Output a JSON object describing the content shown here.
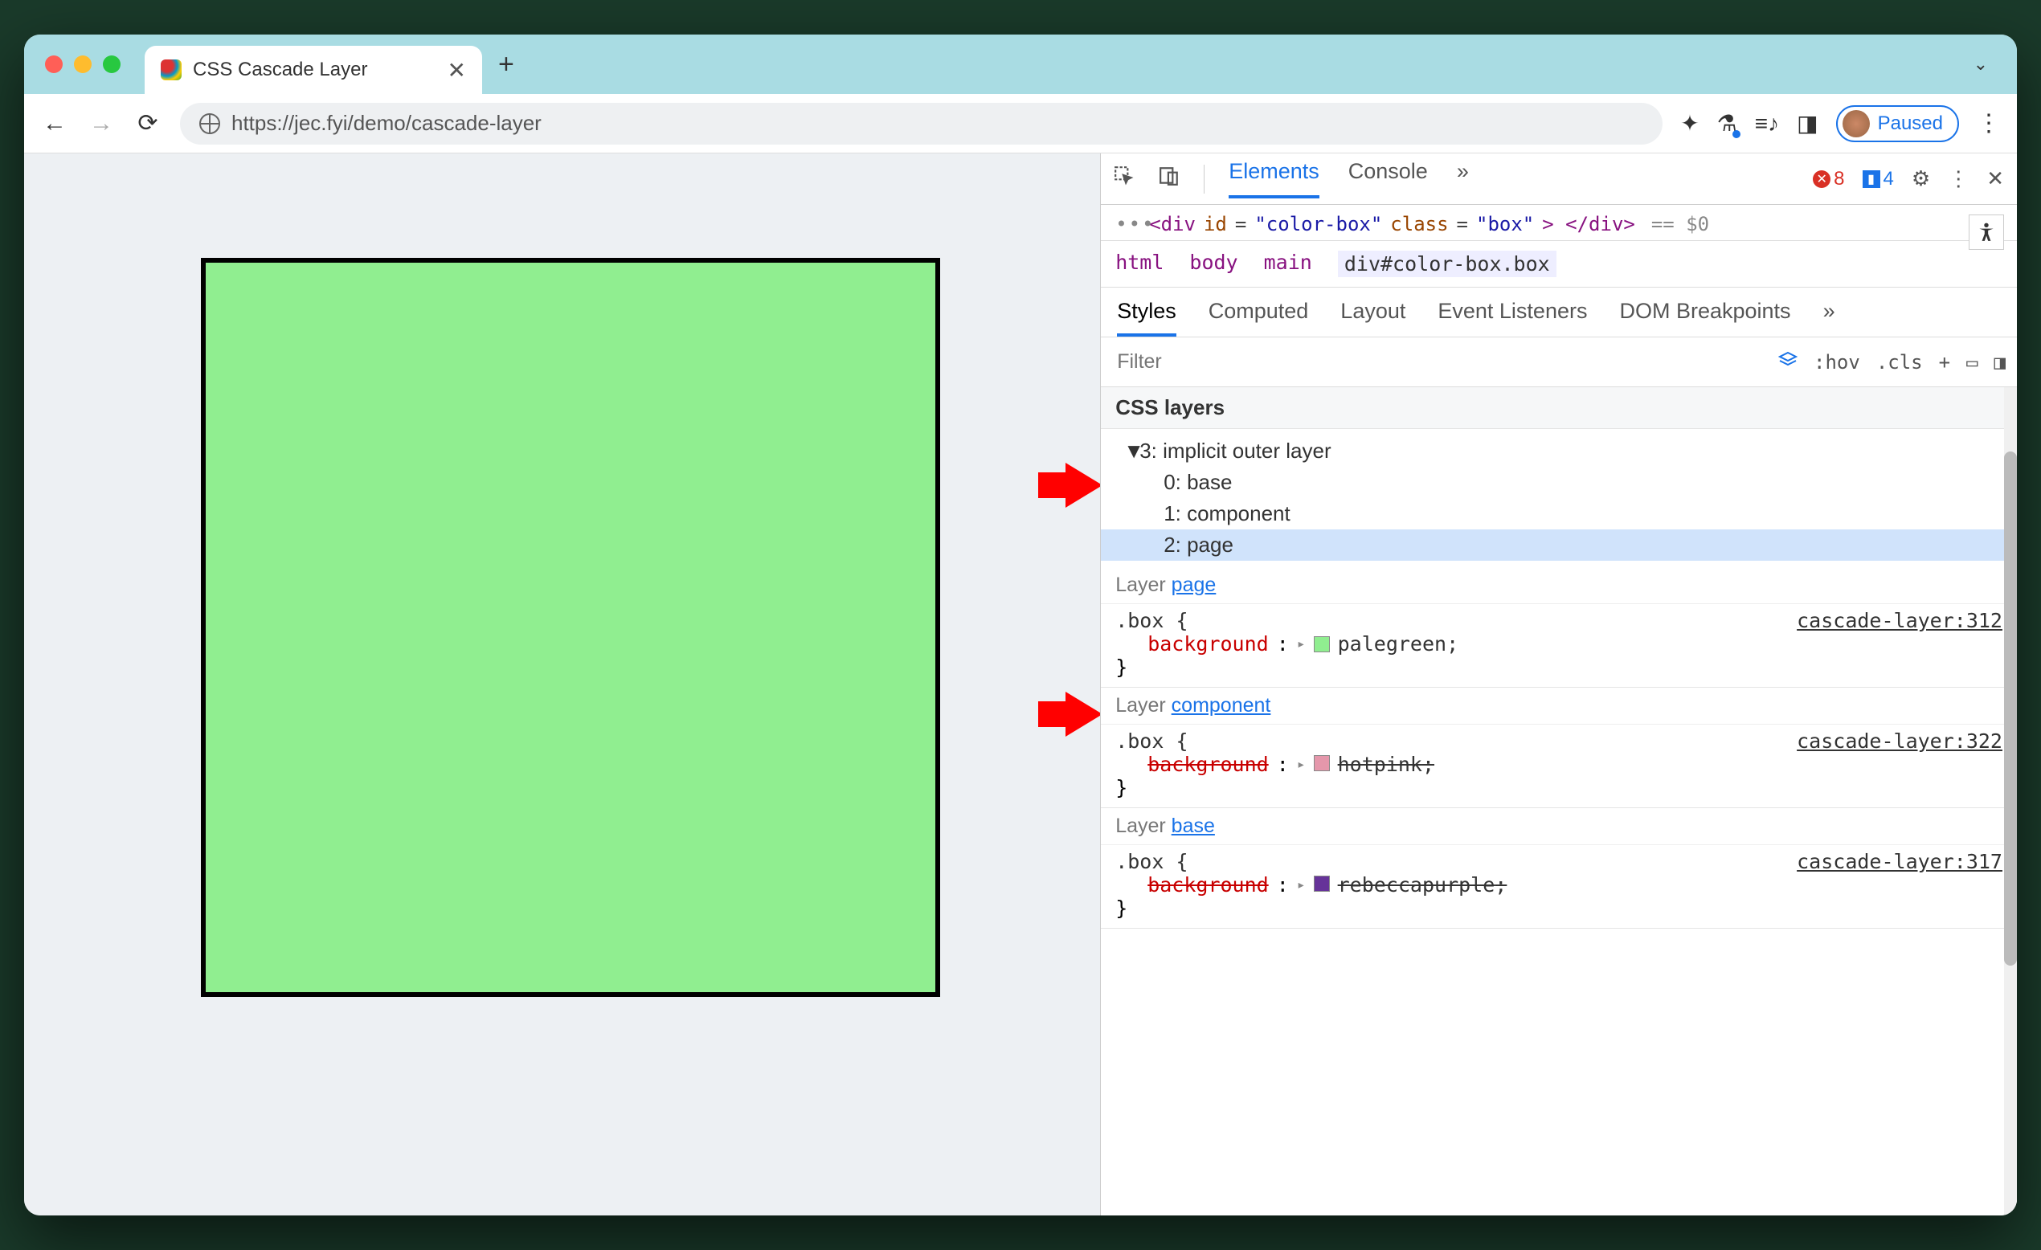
{
  "tab": {
    "title": "CSS Cascade Layer"
  },
  "address": {
    "url": "https://jec.fyi/demo/cascade-layer",
    "paused": "Paused"
  },
  "devtools": {
    "tabs": {
      "elements": "Elements",
      "console": "Console",
      "more": "»"
    },
    "errors": "8",
    "infos": "4",
    "selected_element_html": {
      "open": "<div",
      "id_attr": "id",
      "id_val": "\"color-box\"",
      "class_attr": "class",
      "class_val": "\"box\"",
      "close": "> </div>",
      "eq": "== $0"
    },
    "breadcrumb": [
      "html",
      "body",
      "main",
      "div#color-box.box"
    ],
    "styles_tabs": {
      "styles": "Styles",
      "computed": "Computed",
      "layout": "Layout",
      "event": "Event Listeners",
      "dom": "DOM Breakpoints",
      "more": "»"
    },
    "filter_placeholder": "Filter",
    "toolbar": {
      "hov": ":hov",
      "cls": ".cls",
      "plus": "+"
    },
    "layers_header": "CSS layers",
    "layer_tree": {
      "root": "3: implicit outer layer",
      "items": [
        "0: base",
        "1: component",
        "2: page"
      ]
    },
    "rules": [
      {
        "layer_label": "Layer ",
        "layer_link": "page",
        "selector": ".box {",
        "source": "cascade-layer:312",
        "prop": "background",
        "value": "palegreen",
        "swatch": "#90EE90",
        "struck": false
      },
      {
        "layer_label": "Layer ",
        "layer_link": "component",
        "selector": ".box {",
        "source": "cascade-layer:322",
        "prop": "background",
        "value": "hotpink",
        "swatch": "#e597ab",
        "struck": true
      },
      {
        "layer_label": "Layer ",
        "layer_link": "base",
        "selector": ".box {",
        "source": "cascade-layer:317",
        "prop": "background",
        "value": "rebeccapurple",
        "swatch": "#663399",
        "struck": true
      }
    ]
  }
}
